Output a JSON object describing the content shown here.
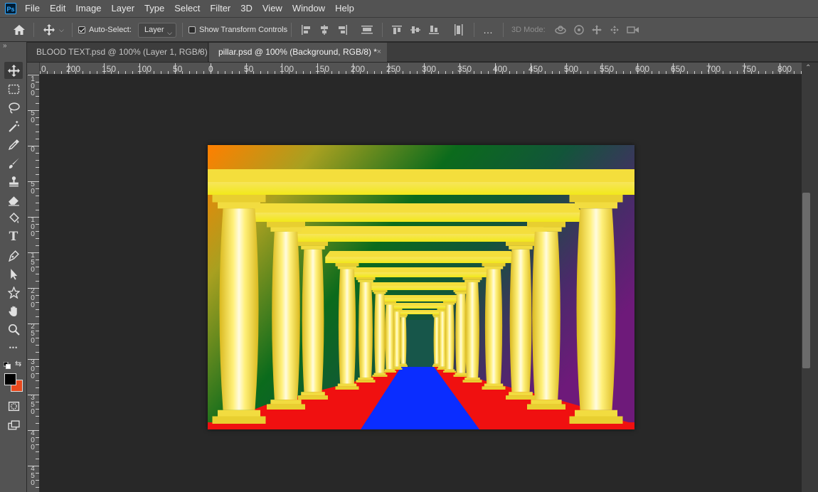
{
  "app": {
    "logo_text": "Ps"
  },
  "menu": [
    "File",
    "Edit",
    "Image",
    "Layer",
    "Type",
    "Select",
    "Filter",
    "3D",
    "View",
    "Window",
    "Help"
  ],
  "options": {
    "auto_select_label": "Auto-Select:",
    "auto_select_checked": true,
    "auto_select_target": "Layer",
    "show_transform_label": "Show Transform Controls",
    "show_transform_checked": false,
    "mode_3d_label": "3D Mode:",
    "more_icon": "…"
  },
  "tabs": [
    {
      "label": "BLOOD TEXT.psd @ 100% (Layer 1, RGB/8)",
      "active": false,
      "close": "×"
    },
    {
      "label": "pillar.psd @ 100% (Background, RGB/8) *",
      "active": true,
      "close": "×"
    }
  ],
  "toolbar": {
    "grip": "»",
    "tools": [
      {
        "name": "move-tool",
        "icon": "move-icon",
        "active": true
      },
      {
        "name": "marquee-tool",
        "icon": "rect-marquee-icon"
      },
      {
        "name": "lasso-tool",
        "icon": "lasso-icon"
      },
      {
        "name": "magic-wand-tool",
        "icon": "magic-wand-icon"
      },
      {
        "name": "eyedropper-tool",
        "icon": "eyedropper-icon"
      },
      {
        "name": "brush-tool",
        "icon": "brush-icon"
      },
      {
        "name": "stamp-tool",
        "icon": "stamp-icon"
      },
      {
        "name": "eraser-tool",
        "icon": "eraser-icon"
      },
      {
        "name": "paint-bucket-tool",
        "icon": "paint-bucket-icon"
      },
      {
        "name": "type-tool",
        "icon": "type-icon",
        "glyph": "T"
      },
      {
        "name": "pen-tool",
        "icon": "pen-icon"
      },
      {
        "name": "path-selection-tool",
        "icon": "arrow-icon"
      },
      {
        "name": "custom-shape-tool",
        "icon": "shape-icon"
      },
      {
        "name": "hand-tool",
        "icon": "hand-icon"
      },
      {
        "name": "zoom-tool",
        "icon": "zoom-icon"
      },
      {
        "name": "more-tools",
        "icon": "ellipsis-icon",
        "glyph": "•••"
      }
    ],
    "foreground_color": "#000000",
    "background_color": "#e8491d"
  },
  "ruler": {
    "horizontal_labels": [
      "0",
      "200",
      "150",
      "100",
      "50",
      "0",
      "50",
      "100",
      "150",
      "200",
      "250",
      "300",
      "350",
      "400",
      "450",
      "500",
      "550",
      "600",
      "650",
      "700",
      "750",
      "800"
    ],
    "vertical_labels": [
      "1 0 0",
      "5 0",
      "0",
      "5 0",
      "1 0 0",
      "1 5 0",
      "2 0 0",
      "2 5 0",
      "3 0 0",
      "3 5 0",
      "4 0 0",
      "4 5 0"
    ]
  },
  "document": {
    "colors": {
      "gradient": [
        "#ff7a00",
        "#0a6a1a",
        "#6a1a7a"
      ],
      "gold": "#f5e23a",
      "carpet_red": "#f01010",
      "carpet_blue": "#0a2dff"
    }
  }
}
